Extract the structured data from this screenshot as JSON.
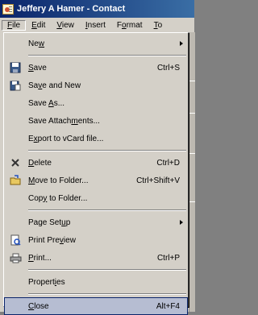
{
  "window": {
    "title": "Jeffery A Hamer - Contact"
  },
  "menubar": [
    {
      "label": "File",
      "u": "F",
      "rest": "ile"
    },
    {
      "label": "Edit",
      "u": "E",
      "rest": "dit"
    },
    {
      "label": "View",
      "u": "V",
      "rest": "iew"
    },
    {
      "label": "Insert",
      "u": "I",
      "rest": "nsert"
    },
    {
      "label": "Format",
      "pre": "F",
      "u": "o",
      "rest": "rmat"
    },
    {
      "label": "To",
      "u": "T",
      "rest": "o"
    }
  ],
  "file_menu": {
    "new": {
      "pre": "Ne",
      "u": "w",
      "post": ""
    },
    "save": {
      "pre": "",
      "u": "S",
      "post": "ave",
      "shortcut": "Ctrl+S"
    },
    "save_and_new": {
      "pre": "Sa",
      "u": "v",
      "post": "e and New"
    },
    "save_as": {
      "pre": "Save ",
      "u": "A",
      "post": "s..."
    },
    "save_attachments": {
      "pre": "Save Attach",
      "u": "m",
      "post": "ents..."
    },
    "export_vcard": {
      "pre": "E",
      "u": "x",
      "post": "port to vCard file..."
    },
    "delete": {
      "pre": "",
      "u": "D",
      "post": "elete",
      "shortcut": "Ctrl+D"
    },
    "move_to_folder": {
      "pre": "",
      "u": "M",
      "post": "ove to Folder...",
      "shortcut": "Ctrl+Shift+V"
    },
    "copy_to_folder": {
      "pre": "Cop",
      "u": "y",
      "post": " to Folder..."
    },
    "page_setup": {
      "pre": "Page Set",
      "u": "u",
      "post": "p"
    },
    "print_preview": {
      "pre": "Print Pre",
      "u": "v",
      "post": "iew"
    },
    "print": {
      "pre": "",
      "u": "P",
      "post": "rint...",
      "shortcut": "Ctrl+P"
    },
    "properties": {
      "pre": "Propert",
      "u": "i",
      "post": "es"
    },
    "close": {
      "pre": "",
      "u": "C",
      "post": "lose",
      "shortcut": "Alt+F4"
    }
  }
}
